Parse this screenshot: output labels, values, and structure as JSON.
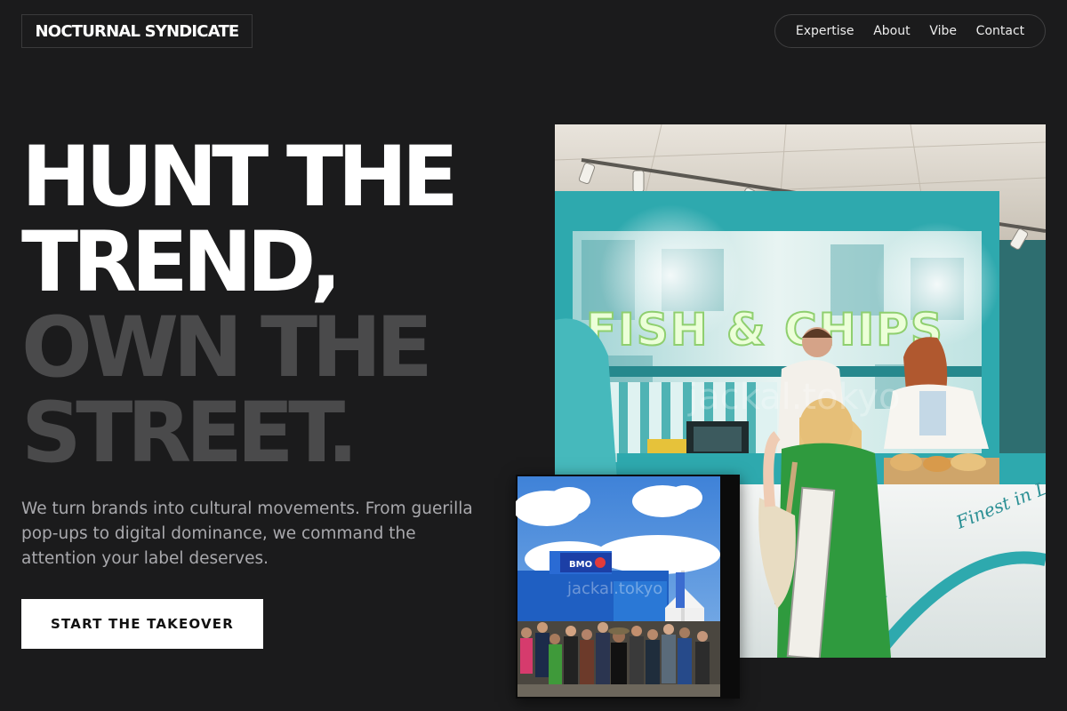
{
  "brand": {
    "name": "NOCTURNAL SYNDICATE"
  },
  "nav": {
    "items": [
      {
        "label": "Expertise"
      },
      {
        "label": "About"
      },
      {
        "label": "Vibe"
      },
      {
        "label": "Contact"
      }
    ]
  },
  "hero": {
    "headline_lines": [
      "HUNT THE",
      "TREND,",
      "OWN THE",
      "STREET."
    ],
    "lede": "We turn brands into cultural movements. From guerilla pop-ups to digital dominance, we command the attention your label deserves.",
    "cta_label": "START THE TAKEOVER"
  },
  "images": {
    "main": {
      "sign_text": "FISH & CHIPS",
      "counter_text": "Finest in London",
      "watermark": "jackal.tokyo"
    },
    "inset": {
      "banner_text": "BMO",
      "watermark": "jackal.tokyo"
    }
  },
  "colors": {
    "background": "#1b1b1c",
    "headline_primary": "#ffffff",
    "headline_secondary": "#4a4a4b",
    "body_text": "#a9a9ad",
    "cta_bg": "#ffffff",
    "cta_text": "#111111"
  }
}
